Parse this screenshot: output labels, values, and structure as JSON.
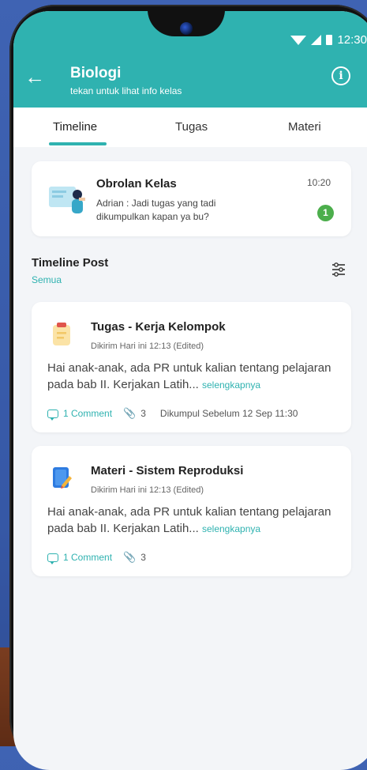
{
  "status": {
    "time": "12:30"
  },
  "header": {
    "title": "Biologi",
    "subtitle": "tekan untuk lihat info kelas",
    "back_icon": "arrow-left-icon",
    "info_icon": "info-icon"
  },
  "tabs": [
    {
      "label": "Timeline",
      "active": true
    },
    {
      "label": "Tugas",
      "active": false
    },
    {
      "label": "Materi",
      "active": false
    }
  ],
  "chat": {
    "title": "Obrolan Kelas",
    "message": "Adrian : Jadi tugas yang tadi dikumpulkan kapan ya bu?",
    "time": "10:20",
    "badge": "1"
  },
  "timeline": {
    "title": "Timeline Post",
    "filter": "Semua"
  },
  "posts": [
    {
      "title": "Tugas - Kerja Kelompok",
      "meta": "Dikirim Hari ini 12:13 (Edited)",
      "body": "Hai anak-anak, ada PR untuk kalian tentang pelajaran pada bab II. Kerjakan Latih...",
      "more": "selengkapnya",
      "comments": "1 Comment",
      "attachments": "3",
      "deadline": "Dikumpul Sebelum 12 Sep 11:30"
    },
    {
      "title": "Materi - Sistem Reproduksi",
      "meta": "Dikirim Hari ini 12:13 (Edited)",
      "body": "Hai anak-anak, ada PR untuk kalian tentang pelajaran pada bab II. Kerjakan Latih...",
      "more": "selengkapnya",
      "comments": "1 Comment",
      "attachments": "3"
    }
  ],
  "colors": {
    "accent": "#2fb2b0",
    "badge": "#4cae4c"
  }
}
